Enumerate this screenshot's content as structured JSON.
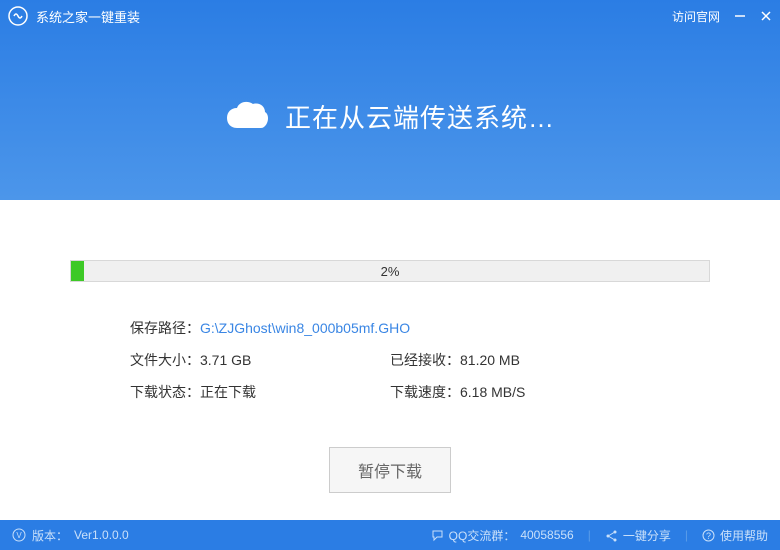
{
  "titlebar": {
    "app_title": "系统之家一键重装",
    "visit_link": "访问官网"
  },
  "hero": {
    "text": "正在从云端传送系统…"
  },
  "progress": {
    "percent_text": "2%",
    "percent_value": 2
  },
  "info": {
    "save_path_label": "保存路径：",
    "save_path_value": "G:\\ZJGhost\\win8_000b05mf.GHO",
    "file_size_label": "文件大小：",
    "file_size_value": "3.71 GB",
    "received_label": "已经接收：",
    "received_value": "81.20 MB",
    "status_label": "下载状态：",
    "status_value": "正在下载",
    "speed_label": "下载速度：",
    "speed_value": "6.18 MB/S"
  },
  "buttons": {
    "pause": "暂停下载"
  },
  "footer": {
    "version_label": "版本：",
    "version_value": "Ver1.0.0.0",
    "qq_label": "QQ交流群：",
    "qq_value": "40058556",
    "share": "一键分享",
    "help": "使用帮助"
  }
}
